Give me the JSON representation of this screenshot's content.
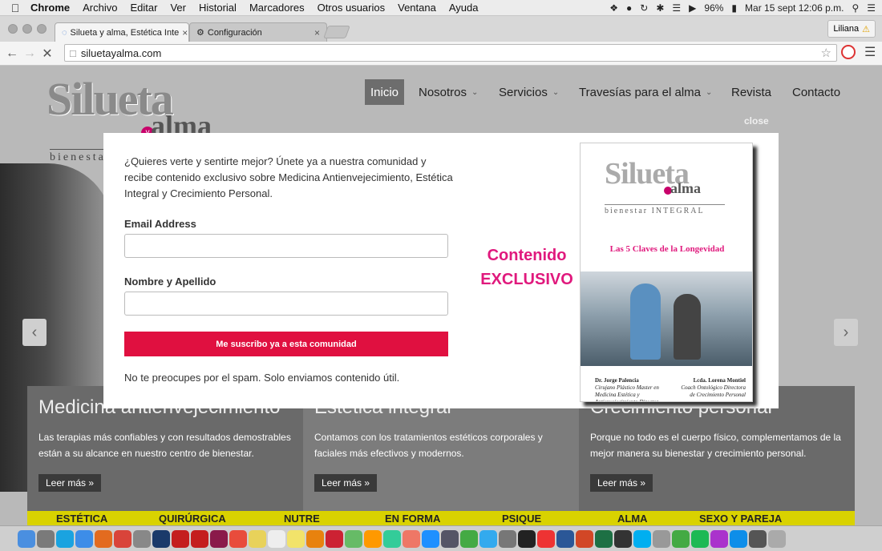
{
  "menubar": {
    "apple": "",
    "items": [
      "Chrome",
      "Archivo",
      "Editar",
      "Ver",
      "Historial",
      "Marcadores",
      "Otros usuarios",
      "Ventana",
      "Ayuda"
    ],
    "battery": "96%",
    "clock": "Mar 15 sept  12:06 p.m."
  },
  "browser": {
    "tabs": [
      {
        "title": "Silueta y alma, Estética Inte",
        "close": "×"
      },
      {
        "title": "Configuración",
        "close": "×"
      }
    ],
    "profile": "Liliana",
    "url": "siluetayalma.com"
  },
  "site": {
    "logo": {
      "word": "Silueta",
      "y": "y",
      "alma": "alma",
      "tagline": "bienestar INTEGRAL"
    },
    "nav": [
      "Inicio",
      "Nosotros",
      "Servicios",
      "Travesías para el alma",
      "Revista",
      "Contacto"
    ],
    "close_label": "close",
    "panels": [
      {
        "title": "Medicina antienvejecimiento",
        "text": "Las terapias más confiables y con resultados demostrables están a su alcance en nuestro centro de bienestar.",
        "button": "Leer más »"
      },
      {
        "title": "Estética integral",
        "text": "Contamos con los tratamientos estéticos corporales y faciales más efectivos y modernos.",
        "button": "Leer más »"
      },
      {
        "title": "Crecimiento personal",
        "text": "Porque no todo es el cuerpo físico, complementamos de la mejor manera su bienestar y crecimiento personal.",
        "button": "Leer más »"
      }
    ],
    "categories": [
      "ESTÉTICA",
      "QUIRÚRGICA",
      "NUTRE",
      "EN FORMA",
      "PSIQUE",
      "ALMA",
      "SEXO Y PAREJA"
    ]
  },
  "modal": {
    "description": "¿Quieres verte y sentirte mejor? Únete ya a nuestra comunidad y recibe contenido exclusivo sobre Medicina Antienvejecimiento, Estética Integral y Crecimiento Personal.",
    "email_label": "Email Address",
    "name_label": "Nombre y Apellido",
    "submit": "Me suscribo ya a esta comunidad",
    "footer": "No te preocupes por el spam. Solo enviamos contenido útil.",
    "exclusive_line1": "Contenido",
    "exclusive_line2": "EXCLUSIVO",
    "book": {
      "word": "Silueta",
      "alma": "alma",
      "tagline": "bienestar INTEGRAL",
      "title": "Las 5 Claves de la Longevidad",
      "author1": "Dr. Jorge Palencia",
      "author1_role": "Cirujano Plástico Master en Medicina Estética y Antienvejecimiento Director General",
      "author2": "Lcda. Lorena Montiel",
      "author2_role": "Coach Ontológico Directora de Crecimiento Personal"
    }
  },
  "colors": {
    "accent": "#e01040",
    "pink": "#e0197d",
    "category_bar": "#d9d200"
  },
  "dock": {
    "icons": [
      "finder-icon",
      "launchpad-icon",
      "skype-icon",
      "safari-icon",
      "firefox-icon",
      "chrome-icon",
      "preview-icon",
      "photoshop-icon",
      "acrobat-icon",
      "reader-icon",
      "indesign-icon",
      "calendar-icon",
      "notes-icon",
      "textedit-icon",
      "stickies-icon",
      "vlc-icon",
      "pinwheel-icon",
      "photos-icon",
      "amazon-icon",
      "itunes-icon",
      "ibooks-icon",
      "appstore-icon",
      "imovie-icon",
      "maps-icon",
      "downloads-icon",
      "quicktime-icon",
      "radiation-icon",
      "popcorn-icon",
      "word-icon",
      "powerpoint-icon",
      "excel-icon",
      "terminal-icon",
      "skype-blue-icon",
      "system-icon",
      "messages-icon",
      "spotify-icon",
      "screen-icon",
      "teamviewer-icon",
      "iphone-icon",
      "trash-icon"
    ]
  }
}
